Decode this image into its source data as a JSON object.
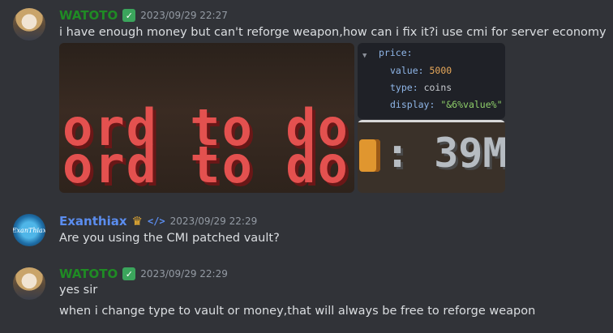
{
  "messages": [
    {
      "author": "WATOTO",
      "timestamp": "2023/09/29 22:27",
      "badge_icon": "green-badge-icon",
      "text": "i have enough money but can't reforge weapon,how can i fix it?i use cmi for server economy",
      "attachments": {
        "game_text_lines": [
          "ord to do",
          "ord to do"
        ],
        "code": {
          "key": "price:",
          "lines": [
            {
              "key": "value:",
              "value": "5000"
            },
            {
              "key": "type:",
              "value": "coins"
            },
            {
              "key": "display:",
              "value": "\"&6%value%\""
            }
          ]
        },
        "game_counter": ": 39M"
      }
    },
    {
      "author": "Exanthiax",
      "timestamp": "2023/09/29 22:29",
      "avatar_text": "ExanThiax",
      "text": "Are you using the CMI patched vault?"
    },
    {
      "author": "WATOTO",
      "timestamp": "2023/09/29 22:29",
      "badge_icon": "green-badge-icon",
      "lines": [
        "yes sir",
        "when i change type to vault or money,that will always be free to reforge weapon"
      ]
    }
  ],
  "colors": {
    "background": "#313338",
    "watoto_name": "#1f8b24",
    "exanthiax_name": "#5b8def",
    "timestamp": "#949ba4"
  }
}
